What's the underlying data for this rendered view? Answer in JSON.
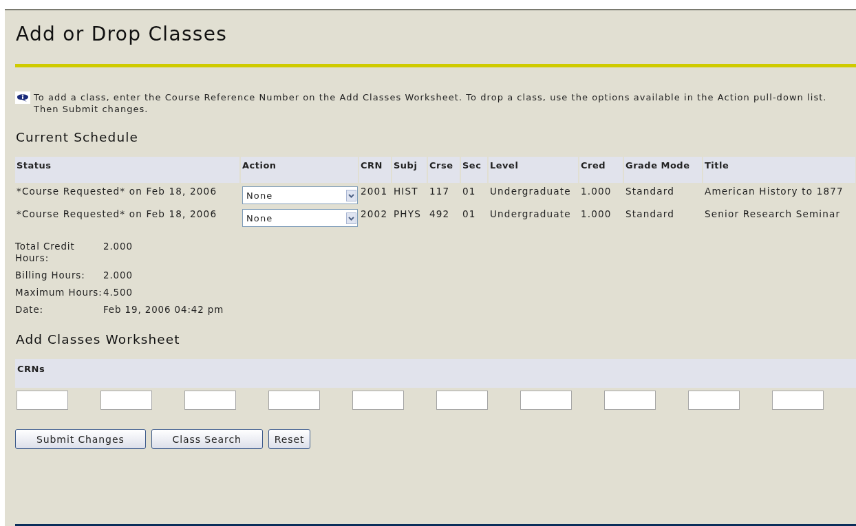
{
  "page": {
    "title": "Add or Drop Classes"
  },
  "info": {
    "text": "To add a class, enter the Course Reference Number on the Add Classes Worksheet. To drop a class, use the options available in the Action pull-down list. Then Submit changes."
  },
  "schedule": {
    "heading": "Current Schedule",
    "columns": [
      "Status",
      "Action",
      "CRN",
      "Subj",
      "Crse",
      "Sec",
      "Level",
      "Cred",
      "Grade Mode",
      "Title"
    ],
    "rows": [
      {
        "status": "*Course Requested* on Feb 18, 2006",
        "action": "None",
        "crn": "2001",
        "subj": "HIST",
        "crse": "117",
        "sec": "01",
        "level": "Undergraduate",
        "cred": "1.000",
        "grade_mode": "Standard",
        "title": "American History to 1877"
      },
      {
        "status": "*Course Requested* on Feb 18, 2006",
        "action": "None",
        "crn": "2002",
        "subj": "PHYS",
        "crse": "492",
        "sec": "01",
        "level": "Undergraduate",
        "cred": "1.000",
        "grade_mode": "Standard",
        "title": "Senior Research Seminar"
      }
    ]
  },
  "summary": [
    {
      "label": "Total Credit Hours:",
      "value": "2.000"
    },
    {
      "label": "Billing Hours:",
      "value": "2.000"
    },
    {
      "label": "Maximum Hours:",
      "value": "4.500"
    },
    {
      "label": "Date:",
      "value": "Feb 19, 2006 04:42 pm"
    }
  ],
  "worksheet": {
    "heading": "Add Classes Worksheet",
    "label": "CRNs",
    "crn_fields": [
      {
        "kind": "input"
      },
      {
        "kind": "input"
      },
      {
        "kind": "input"
      },
      {
        "kind": "input"
      },
      {
        "kind": "input"
      },
      {
        "kind": "input"
      },
      {
        "kind": "input"
      },
      {
        "kind": "input"
      },
      {
        "kind": "input"
      },
      {
        "kind": "input"
      }
    ]
  },
  "buttons": [
    "Submit Changes",
    "Class Search",
    "Reset"
  ]
}
